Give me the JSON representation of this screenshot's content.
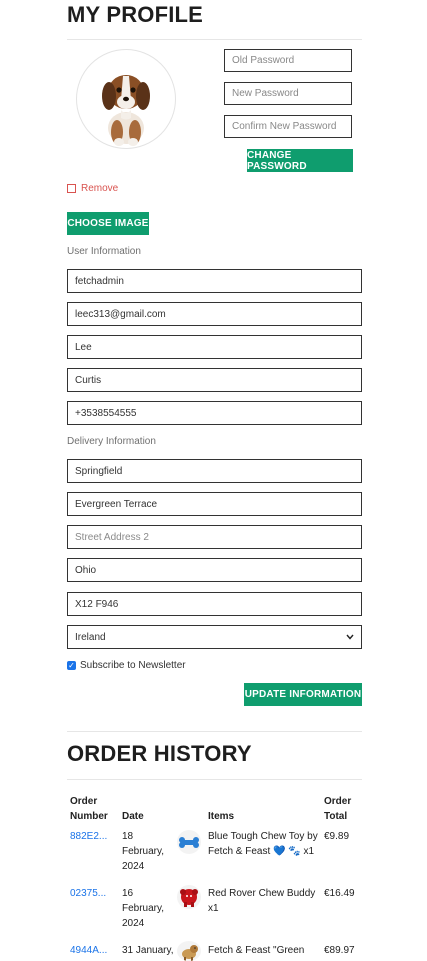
{
  "profile": {
    "title": "MY PROFILE",
    "remove_label": "Remove",
    "choose_image_label": "CHOOSE IMAGE",
    "old_password_placeholder": "Old Password",
    "new_password_placeholder": "New Password",
    "confirm_password_placeholder": "Confirm New Password",
    "change_password_label": "CHANGE PASSWORD"
  },
  "user_info": {
    "heading": "User Information",
    "username": "fetchadmin",
    "email": "leec313@gmail.com",
    "first_name": "Lee",
    "last_name": "Curtis",
    "phone": "+3538554555"
  },
  "delivery": {
    "heading": "Delivery Information",
    "town": "Springfield",
    "street1": "Evergreen Terrace",
    "street2_placeholder": "Street Address 2",
    "county": "Ohio",
    "postcode": "X12 F946",
    "country": "Ireland",
    "newsletter_label": "Subscribe to Newsletter",
    "newsletter_checked": true,
    "update_label": "UPDATE INFORMATION"
  },
  "orders": {
    "title": "ORDER HISTORY",
    "headers": {
      "number_l1": "Order",
      "number_l2": "Number",
      "date": "Date",
      "items": "Items",
      "total_l1": "Order",
      "total_l2": "Total"
    },
    "rows": [
      {
        "number": "882E2...",
        "date_l1": "18",
        "date_l2": "February,",
        "date_l3": "2024",
        "item_l1": "Blue Tough Chew Toy by",
        "item_l2": "Fetch & Feast 💙 🐾 x1",
        "total": "€9.89",
        "thumb_icon": "blue-bone-toy-icon"
      },
      {
        "number": "02375...",
        "date_l1": "16",
        "date_l2": "February,",
        "date_l3": "2024",
        "item_l1": "Red Rover Chew Buddy",
        "item_l2": "x1",
        "total": "€16.49",
        "thumb_icon": "red-rover-toy-icon"
      },
      {
        "number": "4944A...",
        "date_l1": "31 January,",
        "date_l2": "",
        "date_l3": "",
        "item_l1": "Fetch & Feast \"Green",
        "item_l2": "",
        "total": "€89.97",
        "thumb_icon": "dog-figure-icon"
      }
    ]
  },
  "colors": {
    "accent": "#0f9d6e",
    "link": "#1a73e8",
    "danger": "#d9534f"
  }
}
